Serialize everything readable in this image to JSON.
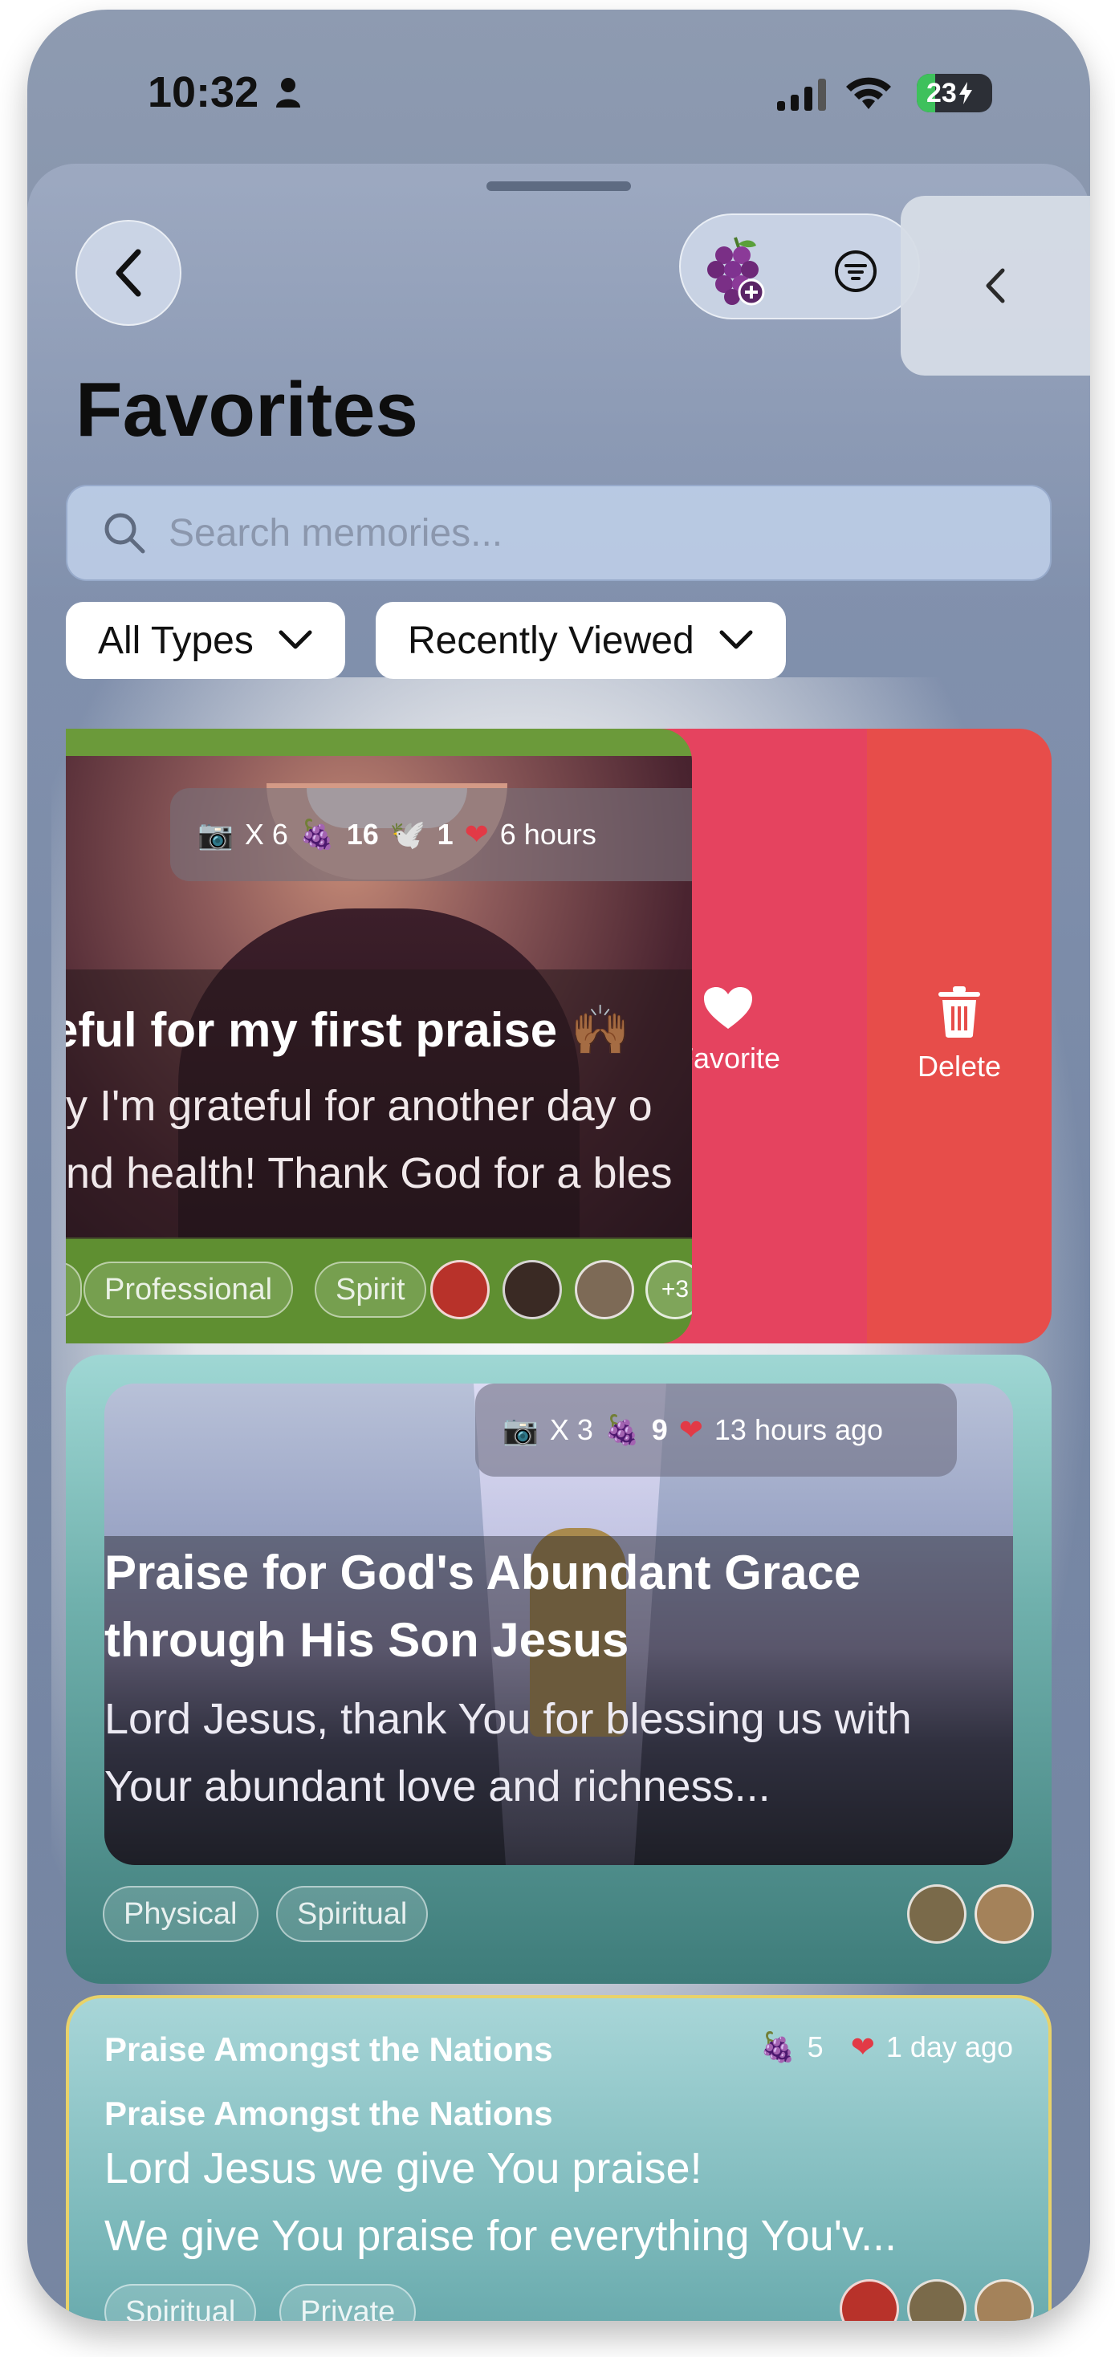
{
  "status_bar": {
    "time": "10:32",
    "battery": "23"
  },
  "header": {
    "title": "Favorites"
  },
  "search": {
    "placeholder": "Search memories..."
  },
  "filters": {
    "type_label": "All Types",
    "sort_label": "Recently Viewed"
  },
  "swipe_actions": {
    "favorite_label": "Favorite",
    "delete_label": "Delete"
  },
  "cards": [
    {
      "photos": "X 6",
      "grapes": "16",
      "doves": "1",
      "time": "6 hours",
      "title": "eful for my first praise 🙌🏾",
      "body_line1": "y I'm grateful for another day o",
      "body_line2": "nd health! Thank God for a bles",
      "tags": [
        "Professional",
        "Spirit"
      ],
      "more_count": "+3"
    },
    {
      "photos": "X 3",
      "grapes": "9",
      "time": "13 hours ago",
      "title": "Praise for God's Abundant Grace through His Son Jesus",
      "body": "Lord Jesus, thank You for blessing us with Your abundant love and richness...",
      "tags": [
        "Physical",
        "Spiritual"
      ]
    },
    {
      "group": "Praise Amongst the Nations",
      "grapes": "5",
      "time": "1 day ago",
      "title": "Praise Amongst the Nations",
      "body_line1": "Lord Jesus we give You praise!",
      "body_line2": "We give You praise for everything You'v...",
      "tags": [
        "Spiritual",
        "Private"
      ]
    }
  ],
  "colors": {
    "favorite_action": "#e5435f",
    "delete_action": "#e74d4a",
    "card3_border": "#e8d26a"
  }
}
